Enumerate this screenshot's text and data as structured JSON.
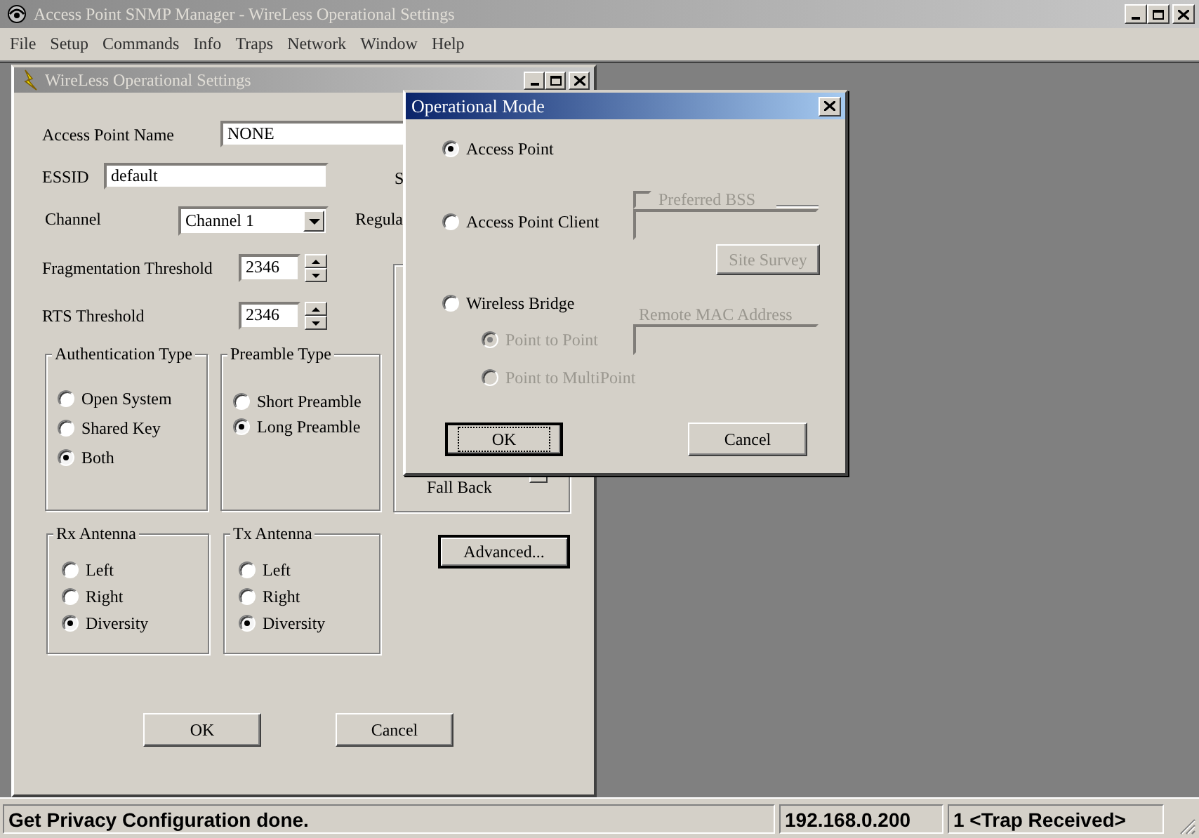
{
  "app_window": {
    "title": "Access Point SNMP Manager -  WireLess Operational Settings"
  },
  "menu": [
    "File",
    "Setup",
    "Commands",
    "Info",
    "Traps",
    "Network",
    "Window",
    "Help"
  ],
  "child_window": {
    "title": "WireLess Operational Settings",
    "fields": [
      {
        "kind": "text",
        "label": "Access Point Name",
        "value": "NONE"
      },
      {
        "kind": "text",
        "label": "ESSID",
        "value": "default"
      },
      {
        "kind": "dropdown",
        "label": "Channel",
        "value": "Channel 1"
      },
      {
        "kind": "spinner",
        "label": "Fragmentation Threshold",
        "value": "2346"
      },
      {
        "kind": "spinner",
        "label": "RTS Threshold",
        "value": "2346"
      }
    ],
    "partial_labels": [
      "S",
      "Regula"
    ],
    "groups": [
      {
        "title": "Authentication Type",
        "options": [
          {
            "label": "Open System",
            "selected": false
          },
          {
            "label": "Shared Key",
            "selected": false
          },
          {
            "label": "Both",
            "selected": true
          }
        ]
      },
      {
        "title": "Preamble Type",
        "options": [
          {
            "label": "Short Preamble",
            "selected": false
          },
          {
            "label": "Long Preamble",
            "selected": true
          }
        ]
      },
      {
        "title": "Rx Antenna",
        "options": [
          {
            "label": "Left",
            "selected": false
          },
          {
            "label": "Right",
            "selected": false
          },
          {
            "label": "Diversity",
            "selected": true
          }
        ]
      },
      {
        "title": "Tx Antenna",
        "options": [
          {
            "label": "Left",
            "selected": false
          },
          {
            "label": "Right",
            "selected": false
          },
          {
            "label": "Diversity",
            "selected": true
          }
        ]
      }
    ],
    "fall_back_label": "Fall Back",
    "advanced_button": "Advanced...",
    "buttons": [
      "OK",
      "Cancel"
    ]
  },
  "dialog": {
    "title": "Operational Mode",
    "modes": [
      {
        "label": "Access Point",
        "selected": true
      },
      {
        "label": "Access Point Client",
        "selected": false
      },
      {
        "label": "Wireless Bridge",
        "selected": false
      }
    ],
    "preferred_bss": {
      "label": "Preferred BSS",
      "checked": false,
      "disabled": true
    },
    "site_survey": {
      "label": "Site Survey",
      "disabled": true
    },
    "remote_mac": {
      "label": "Remote MAC Address",
      "disabled": true
    },
    "bridge_options": [
      {
        "label": "Point to Point",
        "selected": true,
        "disabled": true
      },
      {
        "label": "Point to MultiPoint",
        "selected": false,
        "disabled": true
      }
    ],
    "buttons": [
      {
        "label": "OK",
        "focused": true
      },
      {
        "label": "Cancel",
        "focused": false
      }
    ]
  },
  "status_bar": {
    "message": "Get Privacy Configuration done.",
    "address": "192.168.0.200",
    "traps": "1 <Trap Received>"
  }
}
